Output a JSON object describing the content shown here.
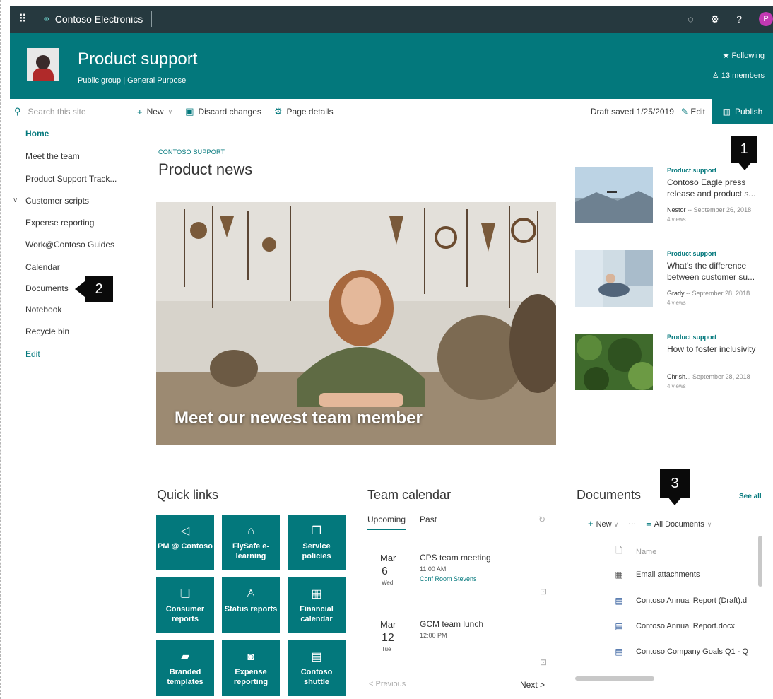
{
  "suite": {
    "brand": "Contoso Electronics",
    "avatar_initial": "P",
    "icons": [
      "app-launcher-icon",
      "notification-icon",
      "settings-icon",
      "help-icon"
    ],
    "help_label": "?"
  },
  "site": {
    "title": "Product support",
    "subtitle": "Public group | General Purpose",
    "following": "Following",
    "members": "13 members"
  },
  "command_bar": {
    "search_placeholder": "Search this site",
    "new_label": "New",
    "discard_label": "Discard changes",
    "page_details_label": "Page details",
    "draft_status": "Draft saved 1/25/2019",
    "edit_label": "Edit",
    "publish_label": "Publish"
  },
  "nav": {
    "items": [
      {
        "label": "Home",
        "active": true
      },
      {
        "label": "Meet the team"
      },
      {
        "label": "Product Support Track..."
      },
      {
        "label": "Customer scripts",
        "expandable": true
      },
      {
        "label": "Expense reporting"
      },
      {
        "label": "Work@Contoso Guides"
      },
      {
        "label": "Calendar"
      },
      {
        "label": "Documents"
      },
      {
        "label": "Notebook"
      },
      {
        "label": "Recycle bin"
      }
    ],
    "edit_label": "Edit"
  },
  "callouts": [
    "1",
    "2",
    "3"
  ],
  "news": {
    "eyebrow": "CONTOSO SUPPORT",
    "title": "Product news",
    "hero_caption": "Meet our newest team member",
    "side_items": [
      {
        "category": "Product support",
        "title": "Contoso Eagle press release and product s...",
        "author": "Nestor",
        "date": "September 26, 2018",
        "views": "4 views"
      },
      {
        "category": "Product support",
        "title": "What's the difference between customer su...",
        "author": "Grady",
        "date": "September 28, 2018",
        "views": "4 views"
      },
      {
        "category": "Product support",
        "title": "How to foster inclusivity",
        "author": "Chrish...",
        "date": "September 28, 2018",
        "views": "4 views"
      }
    ]
  },
  "quick_links": {
    "title": "Quick links",
    "tiles": [
      {
        "label": "PM @ Contoso",
        "icon": "megaphone-icon"
      },
      {
        "label": "FlySafe e-learning",
        "icon": "learning-icon"
      },
      {
        "label": "Service policies",
        "icon": "policy-icon"
      },
      {
        "label": "Consumer reports",
        "icon": "report-icon"
      },
      {
        "label": "Status reports",
        "icon": "person-icon"
      },
      {
        "label": "Financial calendar",
        "icon": "calendar-icon"
      },
      {
        "label": "Branded templates",
        "icon": "powerpoint-icon"
      },
      {
        "label": "Expense reporting",
        "icon": "money-icon"
      },
      {
        "label": "Contoso shuttle",
        "icon": "bus-icon"
      }
    ]
  },
  "calendar": {
    "title": "Team calendar",
    "tabs": [
      "Upcoming",
      "Past"
    ],
    "events": [
      {
        "month": "Mar",
        "day": "6",
        "dow": "Wed",
        "title": "CPS team meeting",
        "time": "11:00 AM",
        "location": "Conf Room Stevens"
      },
      {
        "month": "Mar",
        "day": "12",
        "dow": "Tue",
        "title": "GCM team lunch",
        "time": "12:00 PM",
        "location": ""
      }
    ],
    "previous_label": "Previous",
    "next_label": "Next"
  },
  "documents": {
    "title": "Documents",
    "see_all": "See all",
    "new_label": "New",
    "more_label": "···",
    "view_label": "All Documents",
    "name_header": "Name",
    "rows": [
      {
        "name": "Email attachments",
        "type": "folder"
      },
      {
        "name": "Contoso Annual Report (Draft).d",
        "type": "word"
      },
      {
        "name": "Contoso Annual Report.docx",
        "type": "word"
      },
      {
        "name": "Contoso Company Goals Q1 - Q",
        "type": "word"
      }
    ]
  }
}
